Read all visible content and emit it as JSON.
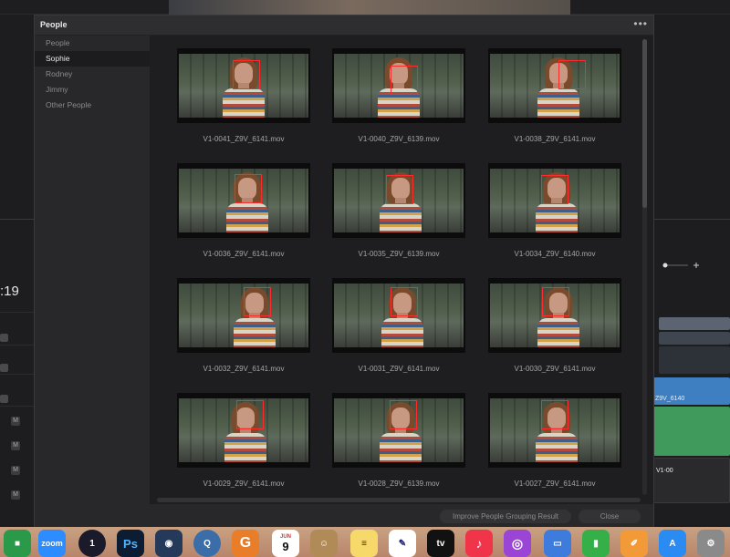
{
  "dialog": {
    "title": "People",
    "menu_label": "•••"
  },
  "sidebar": {
    "items": [
      {
        "label": "People"
      },
      {
        "label": "Sophie"
      },
      {
        "label": "Rodney"
      },
      {
        "label": "Jimmy"
      },
      {
        "label": "Other People"
      }
    ],
    "selected": "Sophie"
  },
  "clips": [
    {
      "name": "V1-0041_Z9V_6141.mov"
    },
    {
      "name": "V1-0040_Z9V_6139.mov"
    },
    {
      "name": "V1-0038_Z9V_6141.mov"
    },
    {
      "name": "V1-0036_Z9V_6141.mov"
    },
    {
      "name": "V1-0035_Z9V_6139.mov"
    },
    {
      "name": "V1-0034_Z9V_6140.mov"
    },
    {
      "name": "V1-0032_Z9V_6141.mov"
    },
    {
      "name": "V1-0031_Z9V_6141.mov"
    },
    {
      "name": "V1-0030_Z9V_6141.mov"
    },
    {
      "name": "V1-0029_Z9V_6141.mov"
    },
    {
      "name": "V1-0028_Z9V_6139.mov"
    },
    {
      "name": "V1-0027_Z9V_6141.mov"
    }
  ],
  "footer": {
    "improve_label": "Improve People Grouping Result",
    "close_label": "Close"
  },
  "background": {
    "timecode": ":19",
    "track_clip_label": "Z9V_6140",
    "track_short_label": "V1-00",
    "mute_label": "M",
    "calendar_month": "JUN",
    "calendar_day": "9"
  },
  "dock": {
    "zoom_label": "zoom",
    "ps_label": "Ps",
    "tv_label": "tv",
    "g_label": "G"
  },
  "colors": {
    "face_box": "#ff2a2a",
    "accent_blue": "#3d7fc1",
    "audio_green": "#3f9a5b"
  }
}
